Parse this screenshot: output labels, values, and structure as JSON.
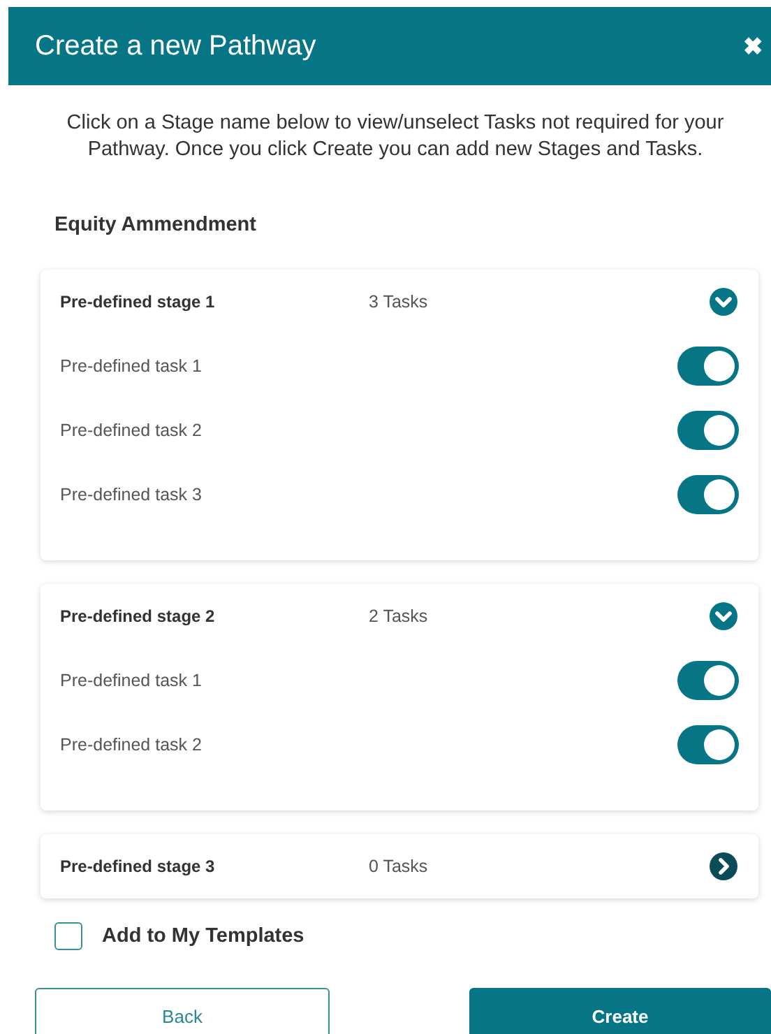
{
  "dialog": {
    "title": "Create a new Pathway",
    "close": "✖"
  },
  "intro": "Click on a Stage name below to view/unselect Tasks not required for your Pathway. Once you click Create you can add new Stages and Tasks.",
  "pathway_name": "Equity Ammendment",
  "stages": [
    {
      "name": "Pre-defined stage 1",
      "count": "3 Tasks",
      "expanded": true,
      "tasks": [
        {
          "name": "Pre-defined task 1",
          "on": true
        },
        {
          "name": "Pre-defined task 2",
          "on": true
        },
        {
          "name": "Pre-defined task 3",
          "on": true
        }
      ]
    },
    {
      "name": "Pre-defined stage 2",
      "count": "2 Tasks",
      "expanded": true,
      "tasks": [
        {
          "name": "Pre-defined task 1",
          "on": true
        },
        {
          "name": "Pre-defined task 2",
          "on": true
        }
      ]
    },
    {
      "name": "Pre-defined stage 3",
      "count": "0 Tasks",
      "expanded": false
    }
  ],
  "template_checkbox": {
    "label": "Add to My Templates",
    "checked": false
  },
  "buttons": [
    {
      "label": "Back",
      "kind": "secondary"
    },
    {
      "label": "Create",
      "kind": "primary"
    }
  ]
}
